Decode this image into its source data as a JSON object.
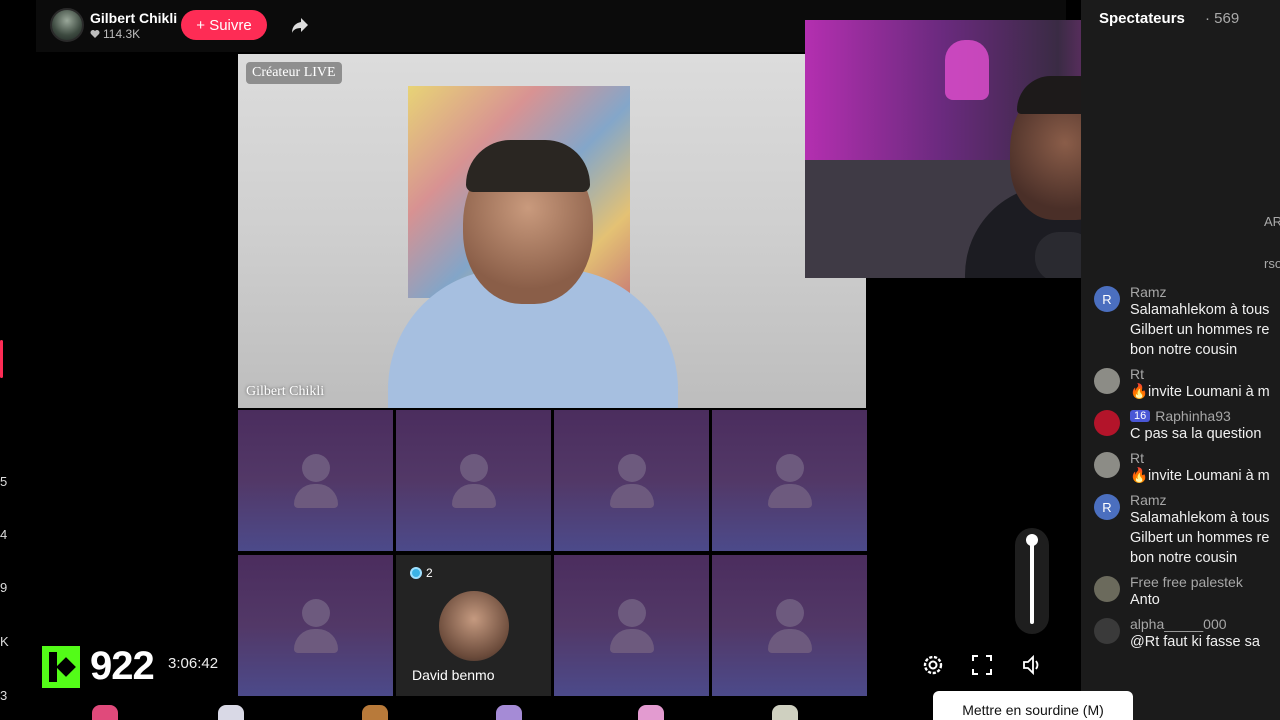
{
  "header": {
    "host_name": "Gilbert Chikli",
    "likes": "114.3K",
    "follow_label": "+ Suivre"
  },
  "main_video": {
    "badge": "Créateur LIVE",
    "caption": "Gilbert Chikli"
  },
  "guests": [
    {
      "name": "David benmo",
      "badge_count": "2"
    }
  ],
  "overlay": {
    "score": "922",
    "timer": "3:06:42"
  },
  "left_ranks": [
    "5",
    "4",
    "9",
    "K",
    "3"
  ],
  "right_panel": {
    "title": "Spectateurs",
    "count": "· 569",
    "peek_text": [
      "AR",
      "rso"
    ]
  },
  "chat": [
    {
      "user": "Ramz",
      "avatar": "R",
      "lines": [
        "Salamahlekom à tous",
        "Gilbert un hommes re",
        "bon notre cousin"
      ]
    },
    {
      "user": "Rt",
      "avatar": "",
      "lines": [
        "🔥invite Loumani à m"
      ]
    },
    {
      "user": "Raphinha93",
      "avatar": "",
      "level": "16",
      "lines": [
        "C pas sa la question"
      ]
    },
    {
      "user": "Rt",
      "avatar": "",
      "lines": [
        "🔥invite Loumani à m"
      ]
    },
    {
      "user": "Ramz",
      "avatar": "R",
      "lines": [
        "Salamahlekom à tous",
        "Gilbert un hommes re",
        "bon notre cousin"
      ]
    },
    {
      "user": "Free free palestek",
      "avatar": "",
      "lines": [
        "Anto"
      ]
    },
    {
      "user": "alpha_____000",
      "avatar": "",
      "lines": [
        "@Rt faut ki fasse sa"
      ]
    }
  ],
  "controls": {
    "mute_tooltip": "Mettre en sourdine (M)",
    "volume_level": 1.0
  },
  "colors": {
    "accent": "#fe2c55",
    "kick_green": "#53fc18",
    "slot_purple": "#523867",
    "level_badge": "#4a57d6"
  },
  "icons": [
    "heart-icon",
    "share-icon",
    "gear-icon",
    "fullscreen-icon",
    "speaker-icon",
    "user-placeholder-icon",
    "diamond-icon"
  ]
}
